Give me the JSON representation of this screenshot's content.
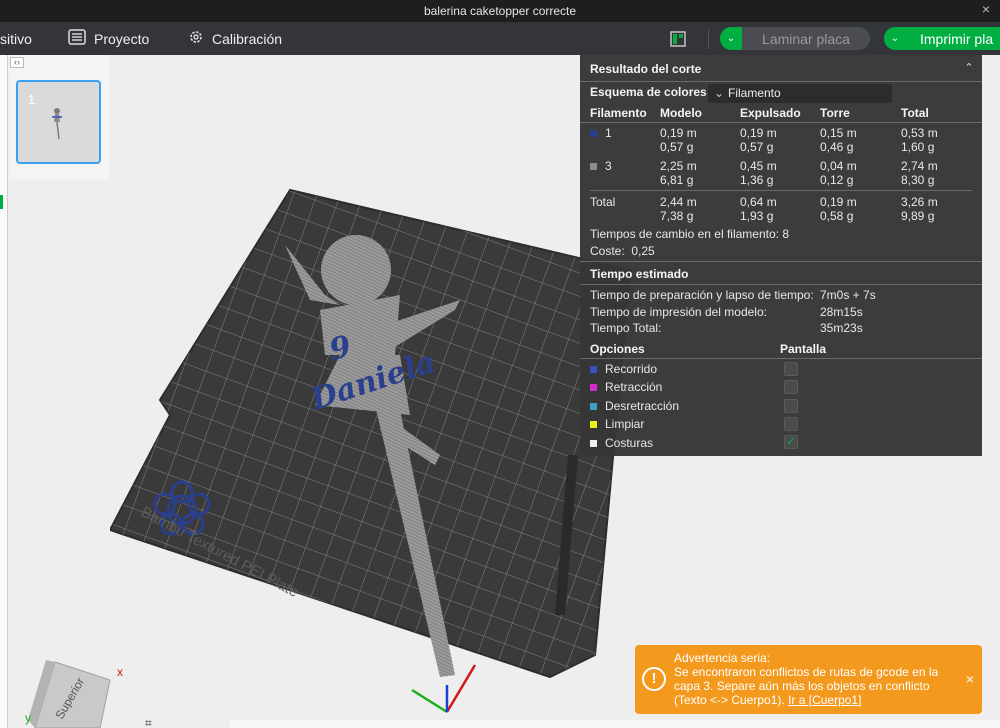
{
  "window": {
    "title": "balerina caketopper correcte",
    "close": "×"
  },
  "toolbar": {
    "device_label": "sitivo",
    "project_label": "Proyecto",
    "calibration_label": "Calibración",
    "slice_label": "Laminar placa",
    "print_label": "Imprimir pla"
  },
  "plate_list": {
    "plate_number": "1",
    "toggle": "‹›"
  },
  "viewport": {
    "bed_label": "Bambu Textured PEI Plate",
    "text_number": "9",
    "text_name": "Daniela",
    "view_cube_label": "Superior",
    "axis_x": "x",
    "axis_y": "y"
  },
  "slice_result": {
    "title": "Resultado del corte",
    "scheme_label": "Esquema de colores",
    "scheme_value": "Filamento",
    "columns": [
      "Filamento",
      "Modelo",
      "Expulsado",
      "Torre",
      "Total"
    ],
    "filaments": [
      {
        "id": "1",
        "color": "#2b3f8f",
        "modelo": [
          "0,19 m",
          "0,57 g"
        ],
        "expulsado": [
          "0,19 m",
          "0,57 g"
        ],
        "torre": [
          "0,15 m",
          "0,46 g"
        ],
        "total": [
          "0,53 m",
          "1,60 g"
        ]
      },
      {
        "id": "3",
        "color": "#8c8c8c",
        "modelo": [
          "2,25 m",
          "6,81 g"
        ],
        "expulsado": [
          "0,45 m",
          "1,36 g"
        ],
        "torre": [
          "0,04 m",
          "0,12 g"
        ],
        "total": [
          "2,74 m",
          "8,30 g"
        ]
      }
    ],
    "total_row": {
      "label": "Total",
      "modelo": [
        "2,44 m",
        "7,38 g"
      ],
      "expulsado": [
        "0,64 m",
        "1,93 g"
      ],
      "torre": [
        "0,19 m",
        "0,58 g"
      ],
      "total": [
        "3,26 m",
        "9,89 g"
      ]
    },
    "change_times_label": "Tiempos de cambio en el filamento:",
    "change_times_value": "8",
    "cost_label": "Coste:",
    "cost_value": "0,25",
    "time_title": "Tiempo estimado",
    "prep_label": "Tiempo de preparación y lapso de tiempo:",
    "prep_value": "7m0s + 7s",
    "print_time_label": "Tiempo de impresión del modelo:",
    "print_time_value": "28m15s",
    "total_time_label": "Tiempo Total:",
    "total_time_value": "35m23s",
    "options_title": "Opciones",
    "display_title": "Pantalla",
    "options": [
      {
        "label": "Recorrido",
        "color": "#3a4fc0",
        "checked": false
      },
      {
        "label": "Retracción",
        "color": "#d62bd0",
        "checked": false
      },
      {
        "label": "Desretracción",
        "color": "#3aa0c8",
        "checked": false
      },
      {
        "label": "Limpiar",
        "color": "#f2ee1a",
        "checked": false
      },
      {
        "label": "Costuras",
        "color": "#f0f0f0",
        "checked": true
      }
    ]
  },
  "warning": {
    "title": "Advertencia seria:",
    "message": "Se encontraron conflictos de rutas de gcode en la capa 3. Separe aún más los objetos en conflicto (Texto <-> Cuerpo1).",
    "link": "Ir a [Cuerpo1]",
    "close": "×",
    "icon": "!"
  }
}
